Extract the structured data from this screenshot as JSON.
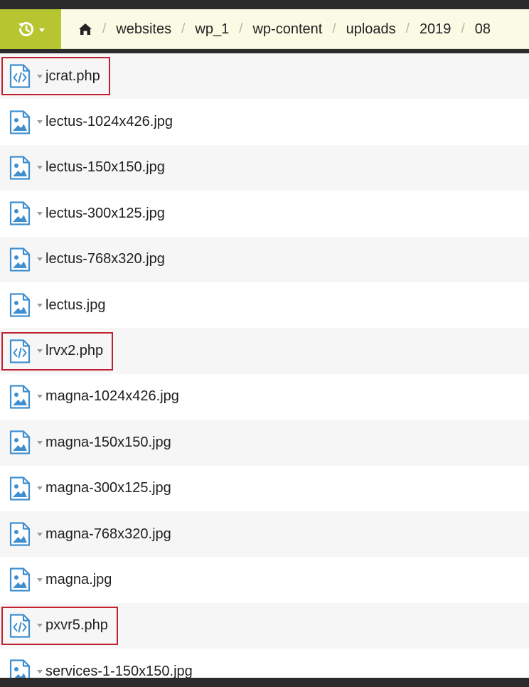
{
  "toolbar": {
    "history_icon": "history-icon",
    "breadcrumb": [
      "websites",
      "wp_1",
      "wp-content",
      "uploads",
      "2019",
      "08"
    ],
    "home_icon": "home-icon"
  },
  "colors": {
    "accent": "#b7c530",
    "toolbar_bg": "#fbfae5",
    "flag_border": "#c0202f",
    "icon_blue": "#3f8fd0"
  },
  "files": [
    {
      "name": "jcrat.php",
      "type": "code",
      "flagged": true
    },
    {
      "name": "lectus-1024x426.jpg",
      "type": "image",
      "flagged": false
    },
    {
      "name": "lectus-150x150.jpg",
      "type": "image",
      "flagged": false
    },
    {
      "name": "lectus-300x125.jpg",
      "type": "image",
      "flagged": false
    },
    {
      "name": "lectus-768x320.jpg",
      "type": "image",
      "flagged": false
    },
    {
      "name": "lectus.jpg",
      "type": "image",
      "flagged": false
    },
    {
      "name": "lrvx2.php",
      "type": "code",
      "flagged": true
    },
    {
      "name": "magna-1024x426.jpg",
      "type": "image",
      "flagged": false
    },
    {
      "name": "magna-150x150.jpg",
      "type": "image",
      "flagged": false
    },
    {
      "name": "magna-300x125.jpg",
      "type": "image",
      "flagged": false
    },
    {
      "name": "magna-768x320.jpg",
      "type": "image",
      "flagged": false
    },
    {
      "name": "magna.jpg",
      "type": "image",
      "flagged": false
    },
    {
      "name": "pxvr5.php",
      "type": "code",
      "flagged": true
    },
    {
      "name": "services-1-150x150.jpg",
      "type": "image",
      "flagged": false
    }
  ]
}
